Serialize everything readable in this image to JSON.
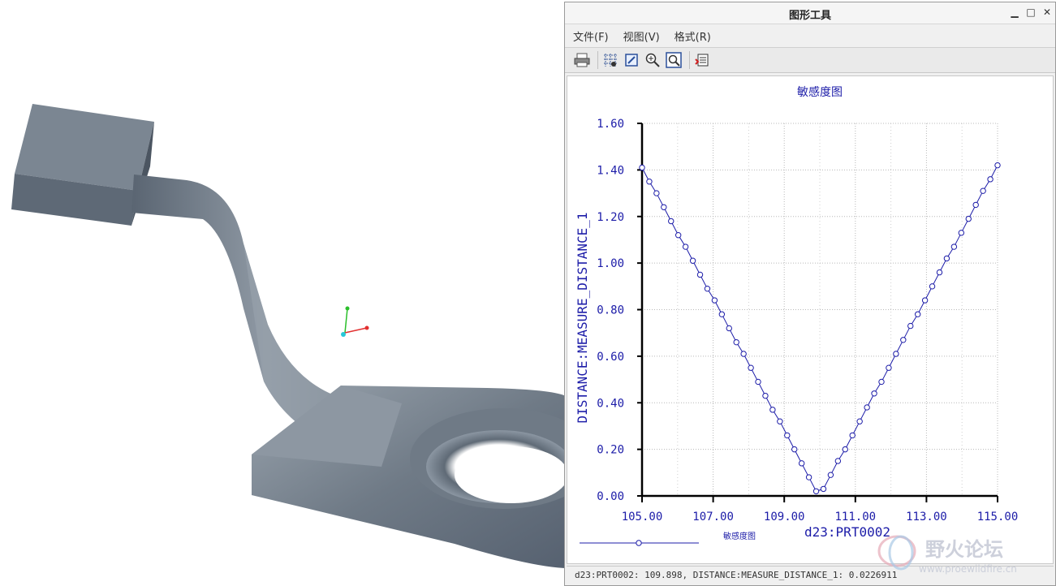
{
  "window": {
    "title": "图形工具",
    "minimize": "▁",
    "maximize": "□",
    "close": "✕"
  },
  "menu": {
    "file": "文件(F)",
    "view": "视图(V)",
    "format": "格式(R)"
  },
  "toolbar": {
    "icons": [
      "printer-icon",
      "grid-icon",
      "edit-icon",
      "zoom-in-icon",
      "zoom-fit-icon",
      "export-icon"
    ]
  },
  "status": {
    "text": "d23:PRT0002: 109.898, DISTANCE:MEASURE_DISTANCE_1: 0.0226911"
  },
  "watermark": {
    "title": "野火论坛",
    "url": "www.proewildfire.cn"
  },
  "chart_data": {
    "type": "line",
    "title": "敏感度图",
    "xlabel": "d23:PRT0002",
    "ylabel": "DISTANCE:MEASURE_DISTANCE_1",
    "xlim": [
      105,
      115
    ],
    "ylim": [
      0,
      1.6
    ],
    "xticks": [
      "105.00",
      "107.00",
      "109.00",
      "111.00",
      "113.00",
      "115.00"
    ],
    "yticks": [
      "0.00",
      "0.20",
      "0.40",
      "0.60",
      "0.80",
      "1.00",
      "1.20",
      "1.40",
      "1.60"
    ],
    "grid": true,
    "legend": "bottom-left",
    "color": "#1c1ca8",
    "series": [
      {
        "name": "敏感度图",
        "x": [
          105.0,
          105.204,
          105.408,
          105.612,
          105.816,
          106.02,
          106.224,
          106.429,
          106.633,
          106.837,
          107.041,
          107.245,
          107.449,
          107.653,
          107.857,
          108.061,
          108.265,
          108.469,
          108.673,
          108.878,
          109.082,
          109.286,
          109.49,
          109.694,
          109.898,
          110.102,
          110.306,
          110.51,
          110.714,
          110.918,
          111.122,
          111.327,
          111.531,
          111.735,
          111.939,
          112.143,
          112.347,
          112.551,
          112.755,
          112.959,
          113.163,
          113.367,
          113.571,
          113.776,
          113.98,
          114.184,
          114.388,
          114.592,
          114.796,
          115.0
        ],
        "y": [
          1.41,
          1.35,
          1.3,
          1.24,
          1.18,
          1.12,
          1.07,
          1.01,
          0.95,
          0.89,
          0.84,
          0.78,
          0.72,
          0.66,
          0.61,
          0.55,
          0.49,
          0.43,
          0.37,
          0.32,
          0.26,
          0.2,
          0.14,
          0.08,
          0.02,
          0.03,
          0.09,
          0.15,
          0.2,
          0.26,
          0.32,
          0.38,
          0.44,
          0.49,
          0.55,
          0.61,
          0.67,
          0.73,
          0.78,
          0.84,
          0.9,
          0.96,
          1.02,
          1.07,
          1.13,
          1.19,
          1.25,
          1.31,
          1.36,
          1.42
        ]
      }
    ]
  }
}
